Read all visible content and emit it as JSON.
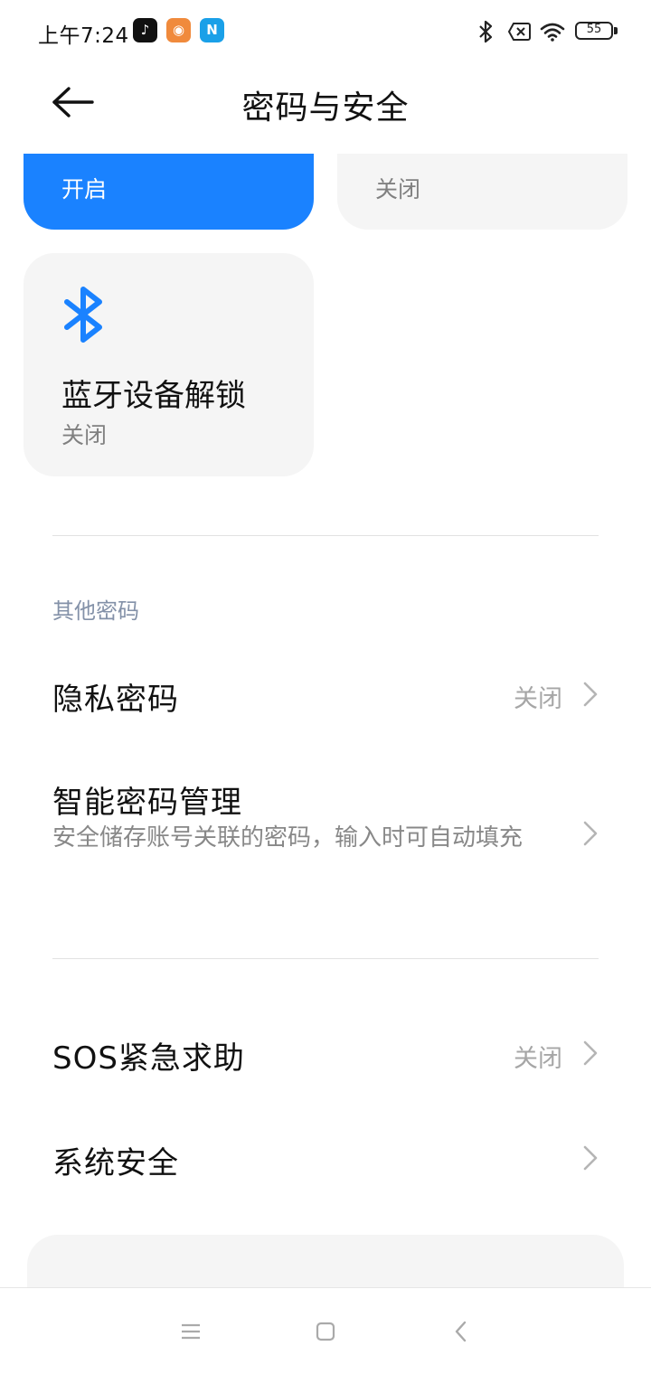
{
  "status_bar": {
    "time": "上午7:24",
    "battery": "55",
    "app_icons": [
      "tiktok-icon",
      "orange-app-icon",
      "n-app-icon"
    ]
  },
  "header": {
    "title": "密码与安全"
  },
  "unlock_cards": [
    {
      "title": "",
      "status": "开启",
      "active": true
    },
    {
      "title": "",
      "status": "关闭",
      "active": false
    },
    {
      "title": "蓝牙设备解锁",
      "status": "关闭",
      "icon": "bluetooth-icon"
    }
  ],
  "other_passwords": {
    "section_label": "其他密码",
    "privacy_password": {
      "title": "隐私密码",
      "value": "关闭"
    },
    "smart_password": {
      "title": "智能密码管理",
      "subtitle": "安全储存账号关联的密码，输入时可自动填充"
    }
  },
  "sos": {
    "title": "SOS紧急求助",
    "value": "关闭"
  },
  "system_security": {
    "title": "系统安全"
  },
  "colors": {
    "accent": "#1a82ff",
    "section_label": "#8391a8"
  }
}
